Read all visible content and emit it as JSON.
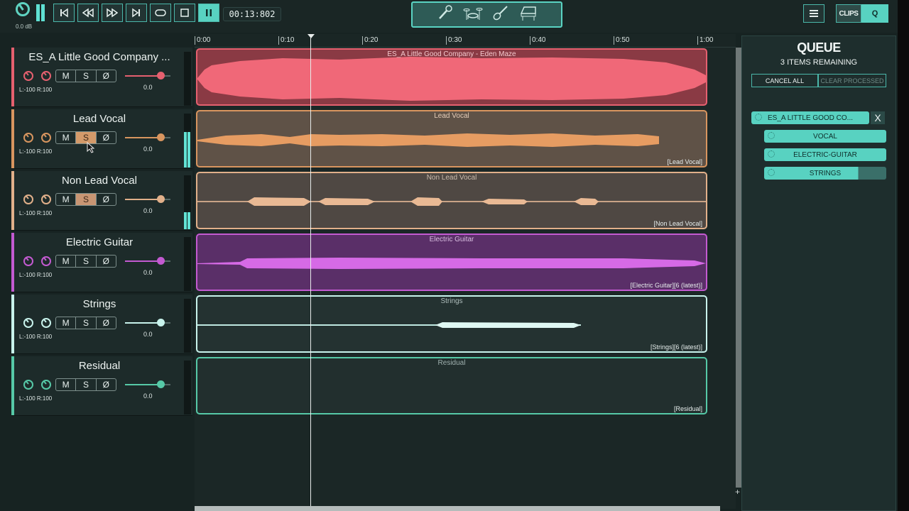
{
  "transport": {
    "master_volume": "0.0 dB",
    "time": "00:13:802",
    "buttons": [
      "skip-back",
      "rewind",
      "fast-forward",
      "skip-forward",
      "loop",
      "stop",
      "pause"
    ]
  },
  "instrument_filter": {
    "icons": [
      "microphone-icon",
      "drums-icon",
      "guitar-icon",
      "piano-icon"
    ]
  },
  "header_right": {
    "menu": "menu-icon",
    "clips_label": "CLIPS",
    "q_label": "Q"
  },
  "ruler": {
    "ticks": [
      "0:00",
      "0:10",
      "0:20",
      "0:30",
      "0:40",
      "0:50",
      "1:00"
    ]
  },
  "tracks": [
    {
      "name": "ES_A Little Good Company ...",
      "clip_title": "ES_A Little Good Company - Eden Maze",
      "clip_tag": "",
      "pan": "L:-100 R:100",
      "volume": "0.0",
      "color": "#e5606f",
      "mute": "M",
      "solo": "S",
      "phase": "Ø",
      "solo_on": false
    },
    {
      "name": "Lead Vocal",
      "clip_title": "Lead Vocal",
      "clip_tag": "[Lead Vocal]",
      "pan": "L:-100 R:100",
      "volume": "0.0",
      "color": "#d8955f",
      "mute": "M",
      "solo": "S",
      "phase": "Ø",
      "solo_on": true
    },
    {
      "name": "Non Lead Vocal",
      "clip_title": "Non Lead Vocal",
      "clip_tag": "[Non Lead Vocal]",
      "pan": "L:-100 R:100",
      "volume": "0.0",
      "color": "#e1b08a",
      "mute": "M",
      "solo": "S",
      "phase": "Ø",
      "solo_on": true
    },
    {
      "name": "Electric Guitar",
      "clip_title": "Electric Guitar",
      "clip_tag": "[Electric Guitar][6 (latest)]",
      "pan": "L:-100 R:100",
      "volume": "0.0",
      "color": "#c35ad1",
      "mute": "M",
      "solo": "S",
      "phase": "Ø",
      "solo_on": false
    },
    {
      "name": "Strings",
      "clip_title": "Strings",
      "clip_tag": "[Strings][6 (latest)]",
      "pan": "L:-100 R:100",
      "volume": "0.0",
      "color": "#c8f3ec",
      "mute": "M",
      "solo": "S",
      "phase": "Ø",
      "solo_on": false
    },
    {
      "name": "Residual",
      "clip_title": "Residual",
      "clip_tag": "[Residual]",
      "pan": "L:-100 R:100",
      "volume": "0.0",
      "color": "#56c9a7",
      "mute": "M",
      "solo": "S",
      "phase": "Ø",
      "solo_on": false
    }
  ],
  "queue": {
    "title": "QUEUE",
    "subtitle": "3 ITEMS REMAINING",
    "cancel_all": "CANCEL ALL",
    "clear_processed": "CLEAR PROCESSED",
    "job": "ES_A LITTLE GOOD CO...",
    "close": "X",
    "items": [
      {
        "label": "VOCAL",
        "progress": 1.0
      },
      {
        "label": "ELECTRIC-GUITAR",
        "progress": 1.0
      },
      {
        "label": "STRINGS",
        "progress": 0.77
      }
    ]
  }
}
